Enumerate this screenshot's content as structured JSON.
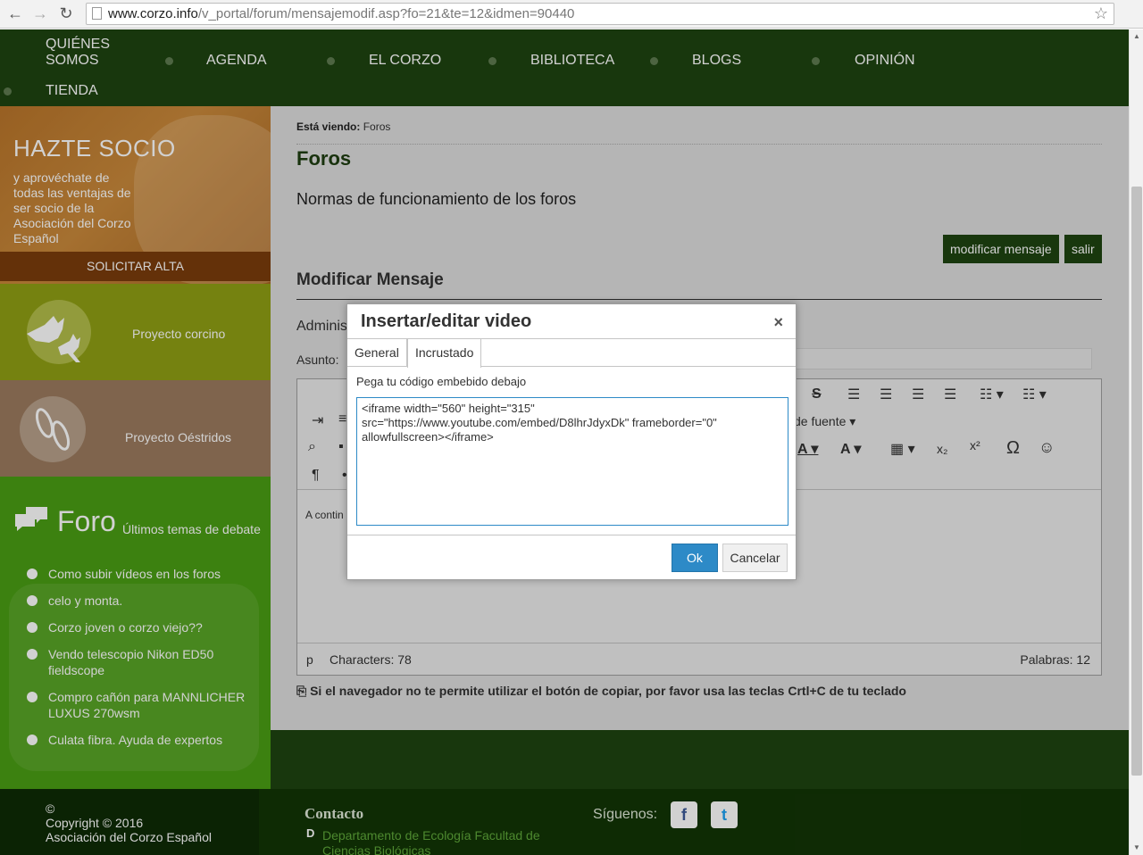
{
  "browser": {
    "url_host": "www.corzo.info",
    "url_path": "/v_portal/forum/mensajemodif.asp?fo=21&te=12&idmen=90440"
  },
  "nav": {
    "items": [
      "QUIÉNES SOMOS",
      "AGENDA",
      "EL CORZO",
      "BIBLIOTECA",
      "BLOGS",
      "OPINIÓN",
      "TIENDA"
    ]
  },
  "sidebar": {
    "hazte_title": "HAZTE SOCIO",
    "hazte_text": "y aprovéchate de todas las ventajas de ser socio de la Asociación del Corzo Español",
    "alta_label": "SOLICITAR ALTA",
    "proyecto1": "Proyecto corcino",
    "proyecto2": "Proyecto Oéstridos",
    "foro_title": "Foro",
    "foro_subtitle": "Últimos temas de debate",
    "foro_items": [
      "Como subir vídeos en los foros",
      "celo y monta.",
      "Corzo joven o corzo viejo??",
      "Vendo telescopio Nikon ED50 fieldscope",
      "Compro cañón para MANNLICHER LUXUS 270wsm",
      "Culata fibra. Ayuda de expertos"
    ]
  },
  "main": {
    "crumb_label": "Está viendo:",
    "crumb_value": "Foros",
    "heading": "Foros",
    "normas": "Normas de funcionamiento de los foros",
    "btn_modificar": "modificar mensaje",
    "btn_salir": "salir",
    "modificar_heading": "Modificar Mensaje",
    "admin_label": "Adminis",
    "asunto_label": "Asunto:",
    "editor_font_label": "de fuente",
    "editor_snippet": "A contin",
    "status_p": "p",
    "status_chars": "Characters: 78",
    "status_words": "Palabras: 12",
    "copy_note": "Si el navegador no te permite utilizar el botón de copiar, por favor usa las teclas Crtl+C de tu teclado"
  },
  "dialog": {
    "title": "Insertar/editar video",
    "close": "×",
    "tab_general": "General",
    "tab_incrustado": "Incrustado",
    "label": "Pega tu código embebido debajo",
    "code": "<iframe width=\"560\" height=\"315\" src=\"https://www.youtube.com/embed/D8lhrJdyxDk\" frameborder=\"0\" allowfullscreen></iframe>",
    "ok": "Ok",
    "cancel": "Cancelar"
  },
  "footer": {
    "copyright": "©\nCopyright © 2016\nAsociación del Corzo Español",
    "contacto": "Contacto",
    "d_letter": "D",
    "department": "Departamento de Ecología Facultad de Ciencias Biológicas",
    "siguenos": "Síguenos:",
    "facebook": "f",
    "twitter": "t"
  },
  "colors": {
    "nav_green": "#1e4410",
    "foro_green": "#4a9e14",
    "ok_blue": "#2d8ac7"
  }
}
